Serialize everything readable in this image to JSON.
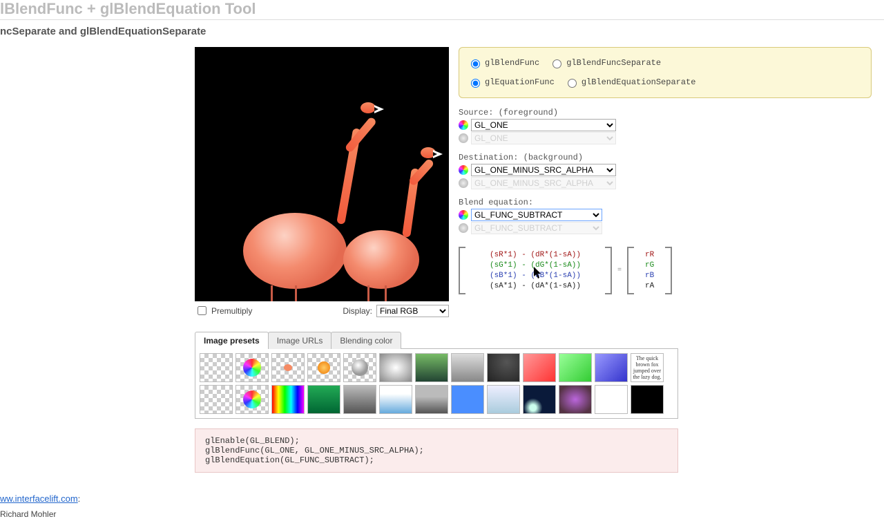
{
  "header": {
    "page_title_partial": "lBlendFunc + glBlendEquation Tool",
    "subtitle_partial": "ncSeparate and glBlendEquationSeparate"
  },
  "radios": {
    "blendFunc": {
      "label": "glBlendFunc",
      "checked": true
    },
    "blendFuncSeparate": {
      "label": "glBlendFuncSeparate",
      "checked": false
    },
    "equationFunc": {
      "label": "glEquationFunc",
      "checked": true
    },
    "blendEquationSeparate": {
      "label": "glBlendEquationSeparate",
      "checked": false
    }
  },
  "source": {
    "label": "Source: (foreground)",
    "value": "GL_ONE",
    "disabled_value": "GL_ONE"
  },
  "destination": {
    "label": "Destination: (background)",
    "value": "GL_ONE_MINUS_SRC_ALPHA",
    "disabled_value": "GL_ONE_MINUS_SRC_ALPHA"
  },
  "equation": {
    "label": "Blend equation:",
    "value": "GL_FUNC_SUBTRACT",
    "disabled_value": "GL_FUNC_SUBTRACT"
  },
  "formula": {
    "lines": [
      {
        "text": "(sR*1) - (dR*(1-sA))",
        "cls": "c-r"
      },
      {
        "text": "(sG*1) - (dG*(1-sA))",
        "cls": "c-g"
      },
      {
        "text": "(sB*1) - (dB*(1-sA))",
        "cls": "c-b"
      },
      {
        "text": "(sA*1) - (dA*(1-sA))",
        "cls": "c-k"
      }
    ],
    "result": [
      {
        "text": "rR",
        "cls": "c-r"
      },
      {
        "text": "rG",
        "cls": "c-g"
      },
      {
        "text": "rB",
        "cls": "c-b"
      },
      {
        "text": "rA",
        "cls": "c-k"
      }
    ],
    "equals": "="
  },
  "display": {
    "premultiply_label": "Premultiply",
    "display_label": "Display:",
    "display_value": "Final RGB"
  },
  "tabs": {
    "presets": "Image presets",
    "urls": "Image URLs",
    "color": "Blending color"
  },
  "swatch_text": "The quick brown fox jumped over the lazy dog.",
  "code": "glEnable(GL_BLEND);\nglBlendFunc(GL_ONE, GL_ONE_MINUS_SRC_ALPHA);\nglBlendEquation(GL_FUNC_SUBTRACT);",
  "footer": {
    "link_text": "ww.interfacelift.com",
    "link_suffix": ":",
    "credit_partial": "Richard Mohler"
  }
}
